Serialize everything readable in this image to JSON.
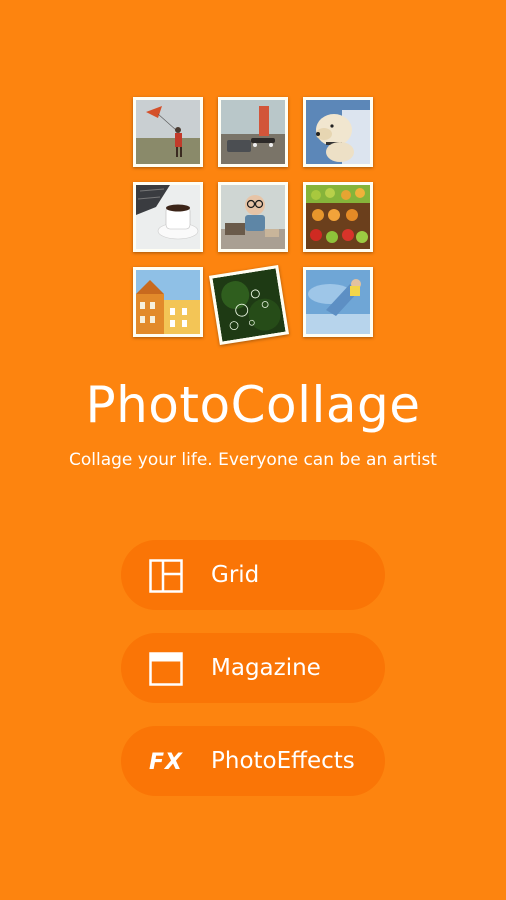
{
  "app": {
    "title": "PhotoCollage",
    "tagline": "Collage your life. Everyone can be an artist"
  },
  "thumbnails": [
    {
      "name": "kite-child-photo"
    },
    {
      "name": "skateboard-photo"
    },
    {
      "name": "dog-photo"
    },
    {
      "name": "coffee-cup-photo"
    },
    {
      "name": "child-glasses-photo"
    },
    {
      "name": "fruit-market-photo"
    },
    {
      "name": "buildings-photo"
    },
    {
      "name": "bubbles-photo"
    },
    {
      "name": "jump-sky-photo"
    }
  ],
  "menu": {
    "items": [
      {
        "label": "Grid",
        "icon": "grid-layout-icon"
      },
      {
        "label": "Magazine",
        "icon": "magazine-layout-icon"
      },
      {
        "label": "PhotoEffects",
        "icon": "fx-icon",
        "icon_text": "FX"
      }
    ]
  },
  "colors": {
    "background": "#fd840f",
    "button": "#fa7506",
    "text": "#ffffff"
  }
}
